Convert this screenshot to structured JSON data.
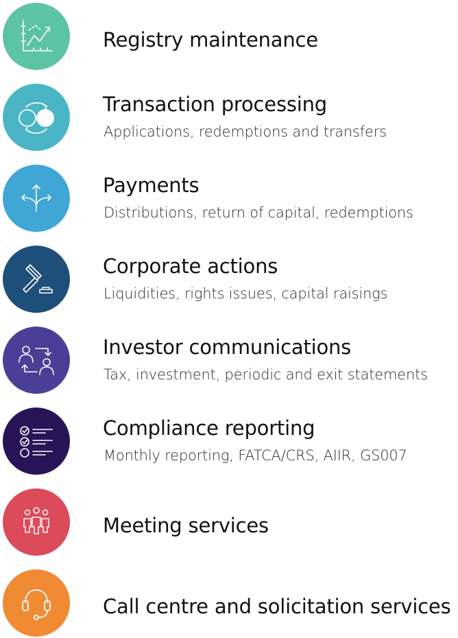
{
  "services": [
    {
      "title": "Registry maintenance",
      "subtitle": "",
      "icon": "line-chart-icon",
      "color": "#5cc4a5"
    },
    {
      "title": "Transaction processing",
      "subtitle": "Applications, redemptions and transfers",
      "icon": "exchange-circles-icon",
      "color": "#4ab5c4"
    },
    {
      "title": "Payments",
      "subtitle": "Distributions, return of capital, redemptions",
      "icon": "split-arrows-icon",
      "color": "#3fa6d6"
    },
    {
      "title": "Corporate actions",
      "subtitle": "Liquidities, rights issues, capital raisings",
      "icon": "gavel-icon",
      "color": "#1d4f7a"
    },
    {
      "title": "Investor communications",
      "subtitle": "Tax, investment, periodic and exit statements",
      "icon": "people-exchange-icon",
      "color": "#4a3f96"
    },
    {
      "title": "Compliance reporting",
      "subtitle": "Monthly reporting, FATCA/CRS, AIIR, GS007",
      "icon": "checklist-icon",
      "color": "#2a1458"
    },
    {
      "title": "Meeting services",
      "subtitle": "",
      "icon": "group-people-icon",
      "color": "#dc4b5a"
    },
    {
      "title": "Call centre and solicitation services",
      "subtitle": "",
      "icon": "headset-icon",
      "color": "#f08a33"
    }
  ]
}
